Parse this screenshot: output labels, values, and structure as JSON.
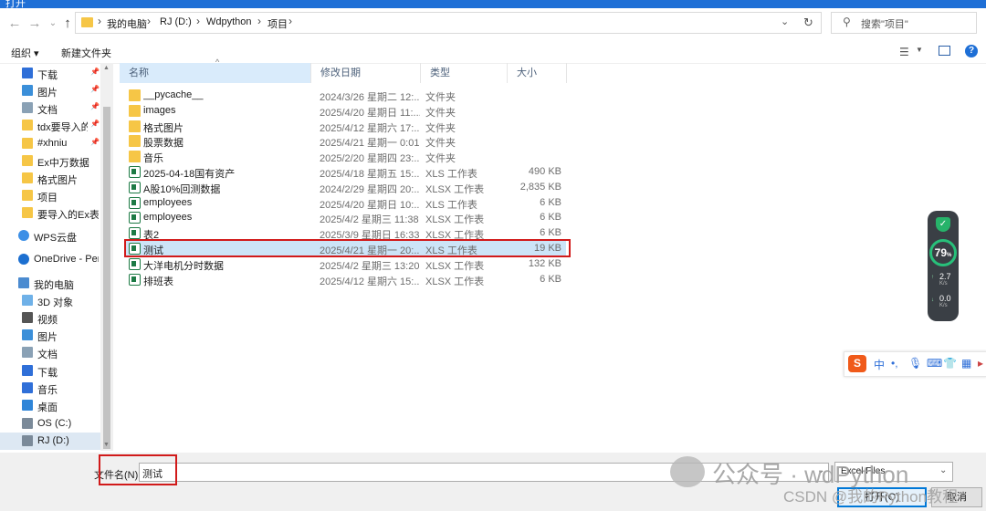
{
  "window": {
    "title": "打开"
  },
  "address": {
    "path": [
      "我的电脑",
      "RJ (D:)",
      "Wdpython",
      "项目"
    ],
    "search_placeholder": "搜索\"项目\""
  },
  "toolbar": {
    "organize": "组织 ▾",
    "new_folder": "新建文件夹"
  },
  "sidebar": {
    "items": [
      {
        "label": "下载",
        "icon": "download-icon",
        "pinned": true
      },
      {
        "label": "图片",
        "icon": "pictures-icon",
        "pinned": true
      },
      {
        "label": "文档",
        "icon": "documents-icon",
        "pinned": true
      },
      {
        "label": "tdx要导入的扌",
        "icon": "folder-icon",
        "pinned": true
      },
      {
        "label": "#xhniu",
        "icon": "folder-icon",
        "pinned": true
      },
      {
        "label": "Ex中万数据",
        "icon": "folder-icon",
        "pinned": false
      },
      {
        "label": "格式图片",
        "icon": "folder-icon",
        "pinned": false
      },
      {
        "label": "项目",
        "icon": "folder-icon",
        "pinned": false
      },
      {
        "label": "要导入的Ex表格",
        "icon": "folder-icon",
        "pinned": false
      },
      {
        "label": "WPS云盘",
        "icon": "cloud-icon",
        "pinned": false
      },
      {
        "label": "OneDrive - Perso",
        "icon": "onedrive-icon",
        "pinned": false
      },
      {
        "label": "我的电脑",
        "icon": "pc-icon",
        "pinned": false
      },
      {
        "label": "3D 对象",
        "icon": "3d-objects-icon",
        "pinned": false
      },
      {
        "label": "视频",
        "icon": "video-icon",
        "pinned": false
      },
      {
        "label": "图片",
        "icon": "pictures-icon",
        "pinned": false
      },
      {
        "label": "文档",
        "icon": "documents-icon",
        "pinned": false
      },
      {
        "label": "下载",
        "icon": "download-icon",
        "pinned": false
      },
      {
        "label": "音乐",
        "icon": "music-icon",
        "pinned": false
      },
      {
        "label": "桌面",
        "icon": "desktop-icon",
        "pinned": false
      },
      {
        "label": "OS (C:)",
        "icon": "drive-icon",
        "pinned": false
      },
      {
        "label": "RJ (D:)",
        "icon": "drive-icon",
        "pinned": false
      }
    ]
  },
  "columns": {
    "name": "名称",
    "date": "修改日期",
    "type": "类型",
    "size": "大小"
  },
  "files": [
    {
      "name": "__pycache__",
      "date": "2024/3/26 星期二 12:...",
      "type": "文件夹",
      "size": "",
      "kind": "folder"
    },
    {
      "name": "images",
      "date": "2025/4/20 星期日 11:...",
      "type": "文件夹",
      "size": "",
      "kind": "folder"
    },
    {
      "name": "格式图片",
      "date": "2025/4/12 星期六 17:...",
      "type": "文件夹",
      "size": "",
      "kind": "folder"
    },
    {
      "name": "股票数据",
      "date": "2025/4/21 星期一 0:01",
      "type": "文件夹",
      "size": "",
      "kind": "folder"
    },
    {
      "name": "音乐",
      "date": "2025/2/20 星期四 23:...",
      "type": "文件夹",
      "size": "",
      "kind": "folder"
    },
    {
      "name": "2025-04-18国有资产",
      "date": "2025/4/18 星期五 15:...",
      "type": "XLS 工作表",
      "size": "490 KB",
      "kind": "xls"
    },
    {
      "name": "A股10%回测数据",
      "date": "2024/2/29 星期四 20:...",
      "type": "XLSX 工作表",
      "size": "2,835 KB",
      "kind": "xls"
    },
    {
      "name": "employees",
      "date": "2025/4/20 星期日 10:...",
      "type": "XLS 工作表",
      "size": "6 KB",
      "kind": "xls"
    },
    {
      "name": "employees",
      "date": "2025/4/2 星期三 11:38",
      "type": "XLSX 工作表",
      "size": "6 KB",
      "kind": "xls"
    },
    {
      "name": "表2",
      "date": "2025/3/9 星期日 16:33",
      "type": "XLSX 工作表",
      "size": "6 KB",
      "kind": "xls"
    },
    {
      "name": "测试",
      "date": "2025/4/21 星期一 20:...",
      "type": "XLS 工作表",
      "size": "19 KB",
      "kind": "xls",
      "selected": true
    },
    {
      "name": "大洋电机分时数据",
      "date": "2025/4/2 星期三 13:20",
      "type": "XLSX 工作表",
      "size": "132 KB",
      "kind": "xls"
    },
    {
      "name": "排班表",
      "date": "2025/4/12 星期六 15:...",
      "type": "XLSX 工作表",
      "size": "6 KB",
      "kind": "xls"
    }
  ],
  "bottom": {
    "filename_label": "文件名(N):",
    "filename_value": "测试",
    "filetype": "Excel Files",
    "open_button": "打开(O)",
    "cancel_button": "取消"
  },
  "monitor": {
    "percent": "79",
    "percent_unit": "%",
    "up": "2.7",
    "down": "0.0",
    "speed_unit": "K/s"
  },
  "ime": {
    "logo": "S",
    "mode": "中"
  },
  "watermarks": {
    "wechat": "公众号 · wdPython",
    "csdn": "CSDN @我的Python教程"
  },
  "colors": {
    "accent": "#1e6fd6",
    "selection": "#cce4f7",
    "highlight_box": "#d11a1a",
    "excel_green": "#1d7a45"
  }
}
